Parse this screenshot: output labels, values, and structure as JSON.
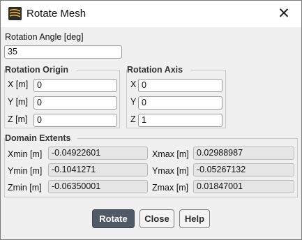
{
  "window": {
    "title": "Rotate Mesh"
  },
  "rotation_angle": {
    "label": "Rotation Angle [deg]",
    "value": "35"
  },
  "rotation_origin": {
    "header": "Rotation Origin",
    "x_label": "X [m]",
    "x_value": "0",
    "y_label": "Y [m]",
    "y_value": "0",
    "z_label": "Z [m]",
    "z_value": "0"
  },
  "rotation_axis": {
    "header": "Rotation Axis",
    "x_label": "X",
    "x_value": "0",
    "y_label": "Y",
    "y_value": "0",
    "z_label": "Z",
    "z_value": "1"
  },
  "domain_extents": {
    "header": "Domain Extents",
    "xmin_label": "Xmin [m]",
    "xmin_value": "-0.04922601",
    "ymin_label": "Ymin [m]",
    "ymin_value": "-0.1041271",
    "zmin_label": "Zmin [m]",
    "zmin_value": "-0.06350001",
    "xmax_label": "Xmax [m]",
    "xmax_value": "0.02988987",
    "ymax_label": "Ymax [m]",
    "ymax_value": "-0.05267132",
    "zmax_label": "Zmax [m]",
    "zmax_value": "0.01847001"
  },
  "buttons": {
    "rotate": "Rotate",
    "close": "Close",
    "help": "Help"
  },
  "colors": {
    "primary_button": "#4f5a66",
    "dialog_bg": "#f0f0f0",
    "readonly_field": "#e6e6e6"
  }
}
